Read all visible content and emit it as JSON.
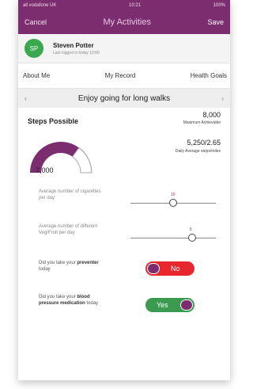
{
  "status_bar": {
    "carrier": "all vodafone UK",
    "time": "10:21",
    "battery": "100%"
  },
  "nav": {
    "cancel": "Cancel",
    "title": "My Activities",
    "save": "Save"
  },
  "user": {
    "initials": "SP",
    "name": "Steven Potter",
    "last_login": "Last logged in today 10:00"
  },
  "tabs": [
    "About Me",
    "My Record",
    "Health Goals"
  ],
  "goal_banner": {
    "text": "Enjoy going for long walks",
    "prev": "‹",
    "next": "›"
  },
  "steps": {
    "title": "Steps Possible",
    "value": "7,000",
    "fill_fraction": 0.7,
    "max_value": "8,000",
    "max_label": "Maximum Achievable",
    "avg_value": "5,250/2.65",
    "avg_label": "Daily Average steps/miles"
  },
  "sliders": [
    {
      "label": "Average number of cigarettes per day",
      "tick": "10",
      "position_fraction": 0.5
    },
    {
      "label": "Average number of different Veg/Fruit per day",
      "tick": "5",
      "position_fraction": 0.72
    }
  ],
  "toggles": [
    {
      "label_pre": "Did you take your",
      "label_bold": "preventer",
      "label_post": "today",
      "value": "No",
      "color": "#e8262e"
    },
    {
      "label_pre": "Did you take your",
      "label_bold": "blood pressure medication",
      "label_post": "today",
      "value": "Yes",
      "color": "#3a9a4f"
    }
  ],
  "colors": {
    "brand": "#7b2d6f",
    "avatar": "#3aa84f",
    "no": "#e8262e",
    "yes": "#3a9a4f"
  }
}
